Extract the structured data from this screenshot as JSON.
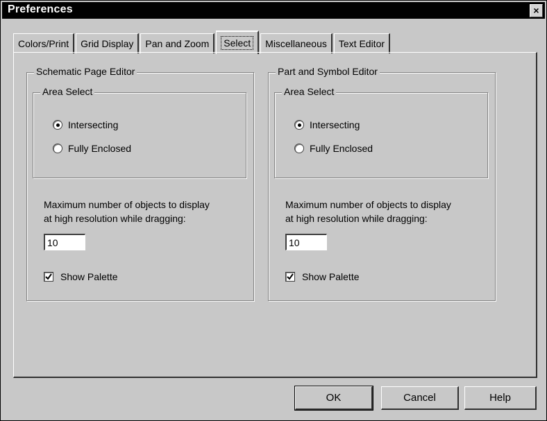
{
  "window": {
    "title": "Preferences"
  },
  "tabs": [
    "Colors/Print",
    "Grid Display",
    "Pan and Zoom",
    "Select",
    "Miscellaneous",
    "Text Editor"
  ],
  "active_tab": "Select",
  "left": {
    "group_title": "Schematic Page Editor",
    "area_select": "Area Select",
    "options": [
      {
        "label": "Intersecting",
        "selected": true
      },
      {
        "label": "Fully Enclosed",
        "selected": false
      }
    ],
    "max_label_line1": "Maximum number of objects to display",
    "max_label_line2": "at high resolution while dragging:",
    "max_value": "10",
    "show_palette": "Show Palette",
    "show_palette_checked": true
  },
  "right": {
    "group_title": "Part and Symbol Editor",
    "area_select": "Area Select",
    "options": [
      {
        "label": "Intersecting",
        "selected": true
      },
      {
        "label": "Fully Enclosed",
        "selected": false
      }
    ],
    "max_label_line1": "Maximum number of objects to display",
    "max_label_line2": "at high resolution while dragging:",
    "max_value": "10",
    "show_palette": "Show Palette",
    "show_palette_checked": true
  },
  "buttons": {
    "ok": "OK",
    "cancel": "Cancel",
    "help": "Help"
  },
  "close_icon": "×"
}
